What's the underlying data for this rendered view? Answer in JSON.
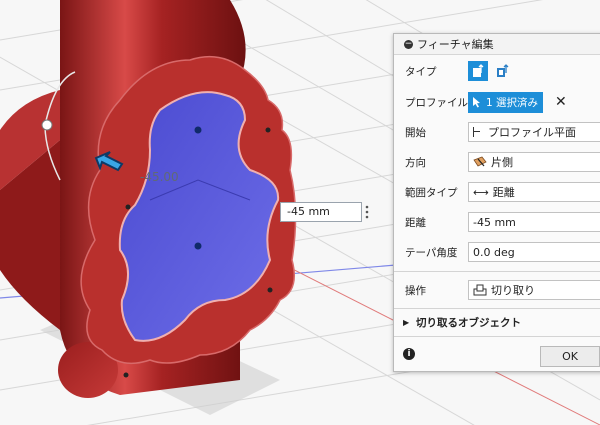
{
  "panel": {
    "title": "フィーチャ編集",
    "rows": {
      "type_label": "タイプ",
      "profile_label": "プロファイル",
      "profile_selected": "1 選択済み",
      "start_label": "開始",
      "start_value": "プロファイル平面",
      "direction_label": "方向",
      "direction_value": "片側",
      "extent_label": "範囲タイプ",
      "extent_value": "距離",
      "distance_label": "距離",
      "distance_value": "-45 mm",
      "taper_label": "テーパ角度",
      "taper_value": "0.0 deg",
      "operation_label": "操作",
      "operation_value": "切り取り",
      "objects_label": "切り取るオブジェクト"
    },
    "ok_label": "OK"
  },
  "viewport": {
    "dim_input_value": "-45 mm",
    "dim_label": "-45.00"
  },
  "colors": {
    "accent": "#1d8ed8",
    "body": "#b22a2a",
    "profile": "#5a5ad8"
  }
}
